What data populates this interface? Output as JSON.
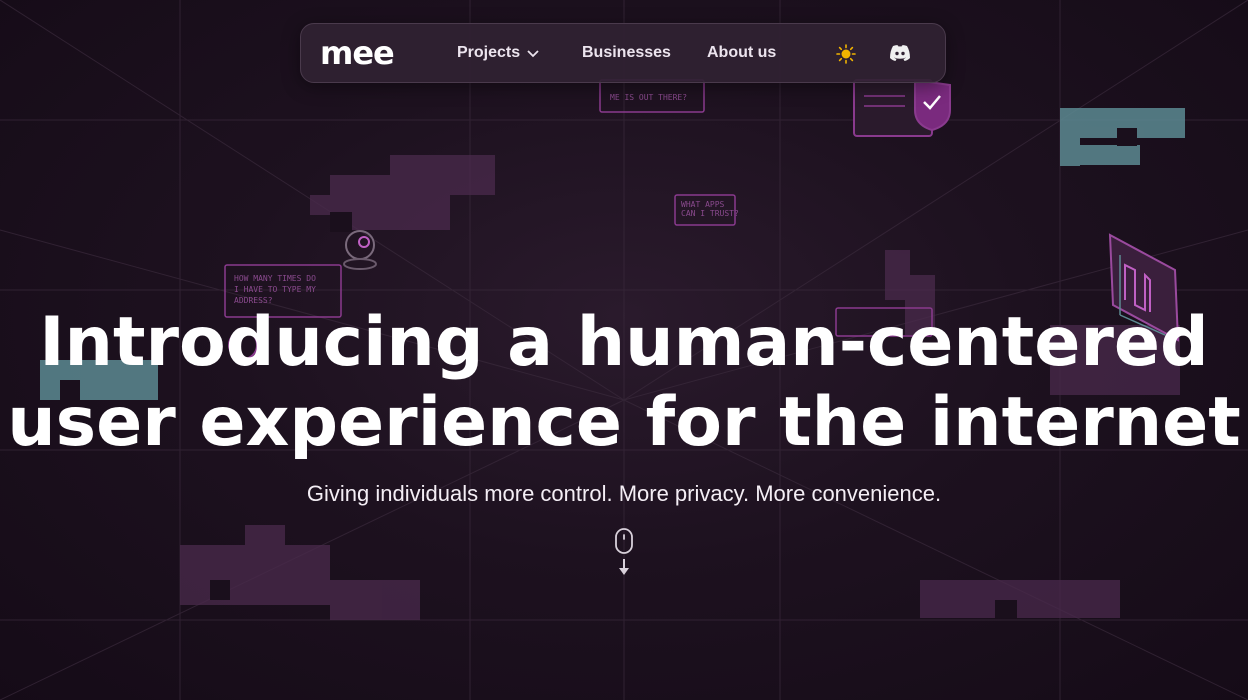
{
  "nav": {
    "logo": "mee",
    "projects_label": "Projects",
    "businesses_label": "Businesses",
    "about_label": "About us"
  },
  "hero": {
    "title_line1": "Introducing a human-centered",
    "title_line2": "user experience for the internet",
    "subtitle": "Giving individuals more control. More privacy. More convenience."
  },
  "bubbles": {
    "b1": "WHAT DATA ABOUT ME IS OUT THERE?",
    "b2": "WHAT APPS CAN I TRUST?",
    "b3": "HOW MANY TIMES DO I HAVE TO TYPE MY ADDRESS?"
  },
  "icons": {
    "theme_toggle": "sun-icon",
    "discord": "discord-icon",
    "scroll": "mouse-icon",
    "arrow": "arrow-down-icon"
  },
  "colors": {
    "background": "#1a0f1c",
    "accent_purple": "#8a3a8e",
    "accent_teal": "#5a8a90",
    "sun": "#f2b400"
  }
}
